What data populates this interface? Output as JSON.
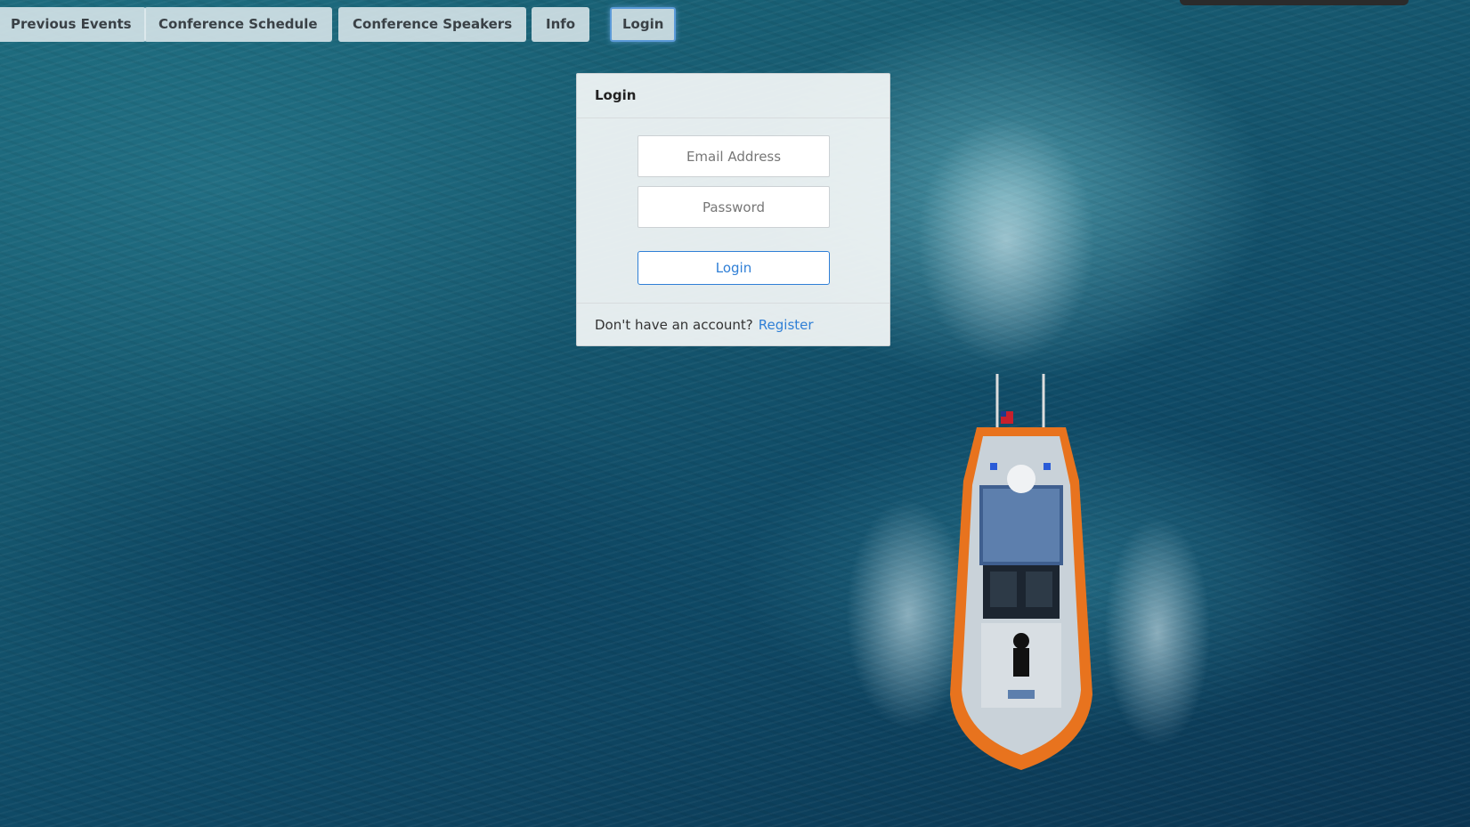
{
  "nav": {
    "items": [
      {
        "label": "Previous Events"
      },
      {
        "label": "Conference Schedule"
      },
      {
        "label": "Conference Speakers"
      },
      {
        "label": "Info"
      },
      {
        "label": "Login",
        "active": true
      }
    ]
  },
  "login_card": {
    "title": "Login",
    "email_placeholder": "Email Address",
    "password_placeholder": "Password",
    "submit_label": "Login",
    "footer_text": "Don't have an account?",
    "register_label": "Register"
  },
  "colors": {
    "accent": "#2f7fd6",
    "nav_active_border": "#5b9ad8",
    "boat_hull": "#e8731e"
  },
  "icons": {
    "background": "ocean-boat-photo"
  }
}
